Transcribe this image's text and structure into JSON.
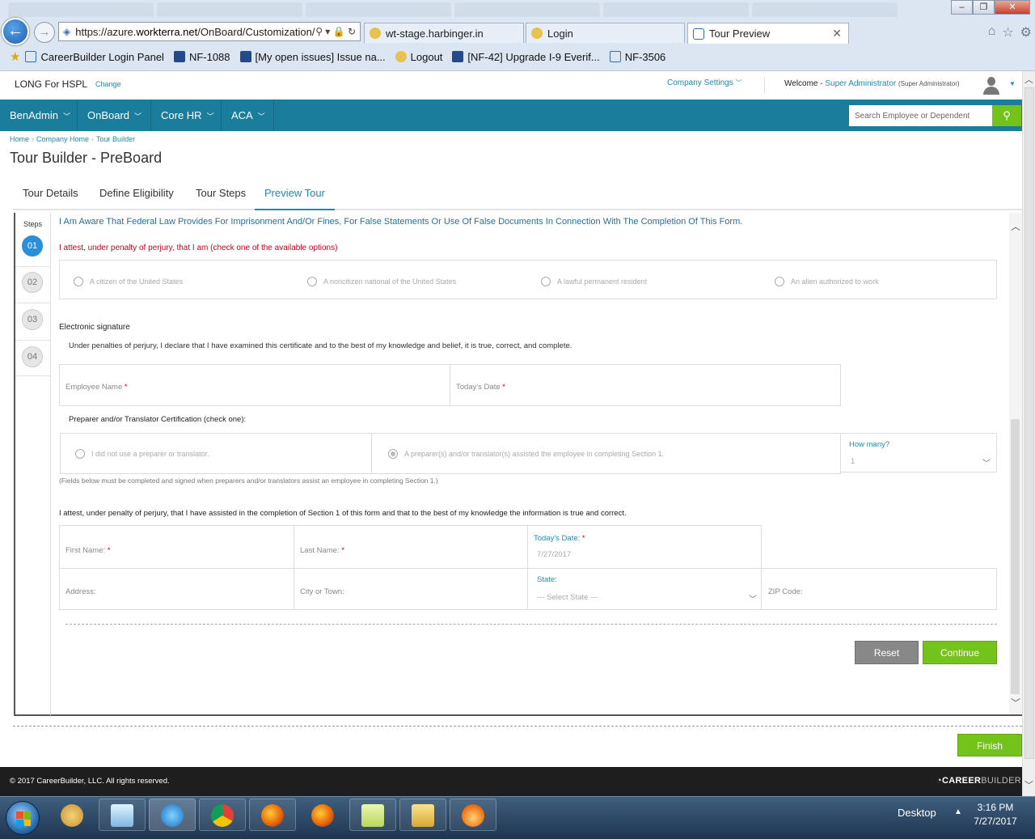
{
  "browser": {
    "url_prefix": "https://azure.",
    "url_domain": "workterra.net",
    "url_rest": "/OnBoard/Customization/",
    "url_controls": "⚲ ▾ 🔒 ↻",
    "tabs": [
      {
        "label": "wt-stage.harbinger.in"
      },
      {
        "label": "Login"
      },
      {
        "label": "Tour Preview"
      }
    ],
    "favorites": [
      {
        "label": "CareerBuilder Login Panel"
      },
      {
        "label": "NF-1088"
      },
      {
        "label": "[My open issues] Issue na..."
      },
      {
        "label": "Logout"
      },
      {
        "label": "[NF-42] Upgrade I-9 Everif..."
      },
      {
        "label": "NF-3506"
      }
    ]
  },
  "header": {
    "company": "LONG For HSPL",
    "change": "Change",
    "company_settings": "Company Settings",
    "welcome": "Welcome - ",
    "user": "Super Administrator",
    "role": "(Super Administrator)"
  },
  "nav": {
    "items": [
      {
        "label": "BenAdmin"
      },
      {
        "label": "OnBoard"
      },
      {
        "label": "Core HR"
      },
      {
        "label": "ACA"
      }
    ],
    "search_placeholder": "Search Employee or Dependent"
  },
  "breadcrumb": [
    "Home",
    "Company Home",
    "Tour Builder"
  ],
  "page_title": "Tour Builder - PreBoard",
  "tabs": [
    {
      "label": "Tour Details"
    },
    {
      "label": "Define Eligibility"
    },
    {
      "label": "Tour Steps"
    },
    {
      "label": "Preview Tour"
    }
  ],
  "steps": {
    "label": "Steps",
    "items": [
      "01",
      "02",
      "03",
      "04"
    ]
  },
  "form": {
    "aware_text": "I Am Aware That Federal Law Provides For Imprisonment And/Or Fines, For False Statements Or Use Of False Documents In Connection With The Completion Of This Form.",
    "attest_text": "I attest, under penalty of perjury, that I am (check one of the available options)",
    "status_options": [
      "A citizen of the United States",
      "A noncitizen national of the United States",
      "A lawful permanent resident",
      "An alien authorized to work"
    ],
    "esig_title": "Electronic signature",
    "declaration": "Under penalties of perjury, I declare that I have examined this certificate and to the best of my knowledge and belief, it is true, correct, and complete.",
    "employee_name_label": "Employee Name",
    "todays_date_label": "Today's Date",
    "preparer_title": "Preparer and/or Translator Certification (check one):",
    "preparer_options": [
      "I did not use a preparer or translator.",
      "A preparer(s) and/or translator(s) assisted the employee in completing Section 1."
    ],
    "how_many_label": "How many?",
    "how_many_value": "1",
    "preparer_note": "(Fields below must be completed and signed when preparers and/or translators assist an employee in completing Section 1.)",
    "preparer_attest": "I attest, under penalty of perjury, that I have assisted in the completion of Section 1 of this form and that to the best of my knowledge the information is true and correct.",
    "first_name_label": "First Name:",
    "last_name_label": "Last Name:",
    "prep_date_label": "Today's Date:",
    "prep_date_value": "7/27/2017",
    "address_label": "Address:",
    "city_label": "City or Town:",
    "state_label": "State:",
    "state_value": "--- Select State ---",
    "zip_label": "ZIP Code:",
    "required_mark": "*",
    "reset": "Reset",
    "continue": "Continue"
  },
  "finish": "Finish",
  "footer": {
    "copyright": "© 2017 CareerBuilder, LLC. All rights reserved.",
    "logo_bold": "CAREER",
    "logo_light": "BUILDER"
  },
  "taskbar": {
    "desktop": "Desktop",
    "time": "3:16 PM",
    "date": "7/27/2017"
  },
  "colors": {
    "nav_bg": "#1a7d9c",
    "accent_link": "#1f8bb5",
    "green_button": "#74c31b",
    "required_red": "#d0021b"
  }
}
